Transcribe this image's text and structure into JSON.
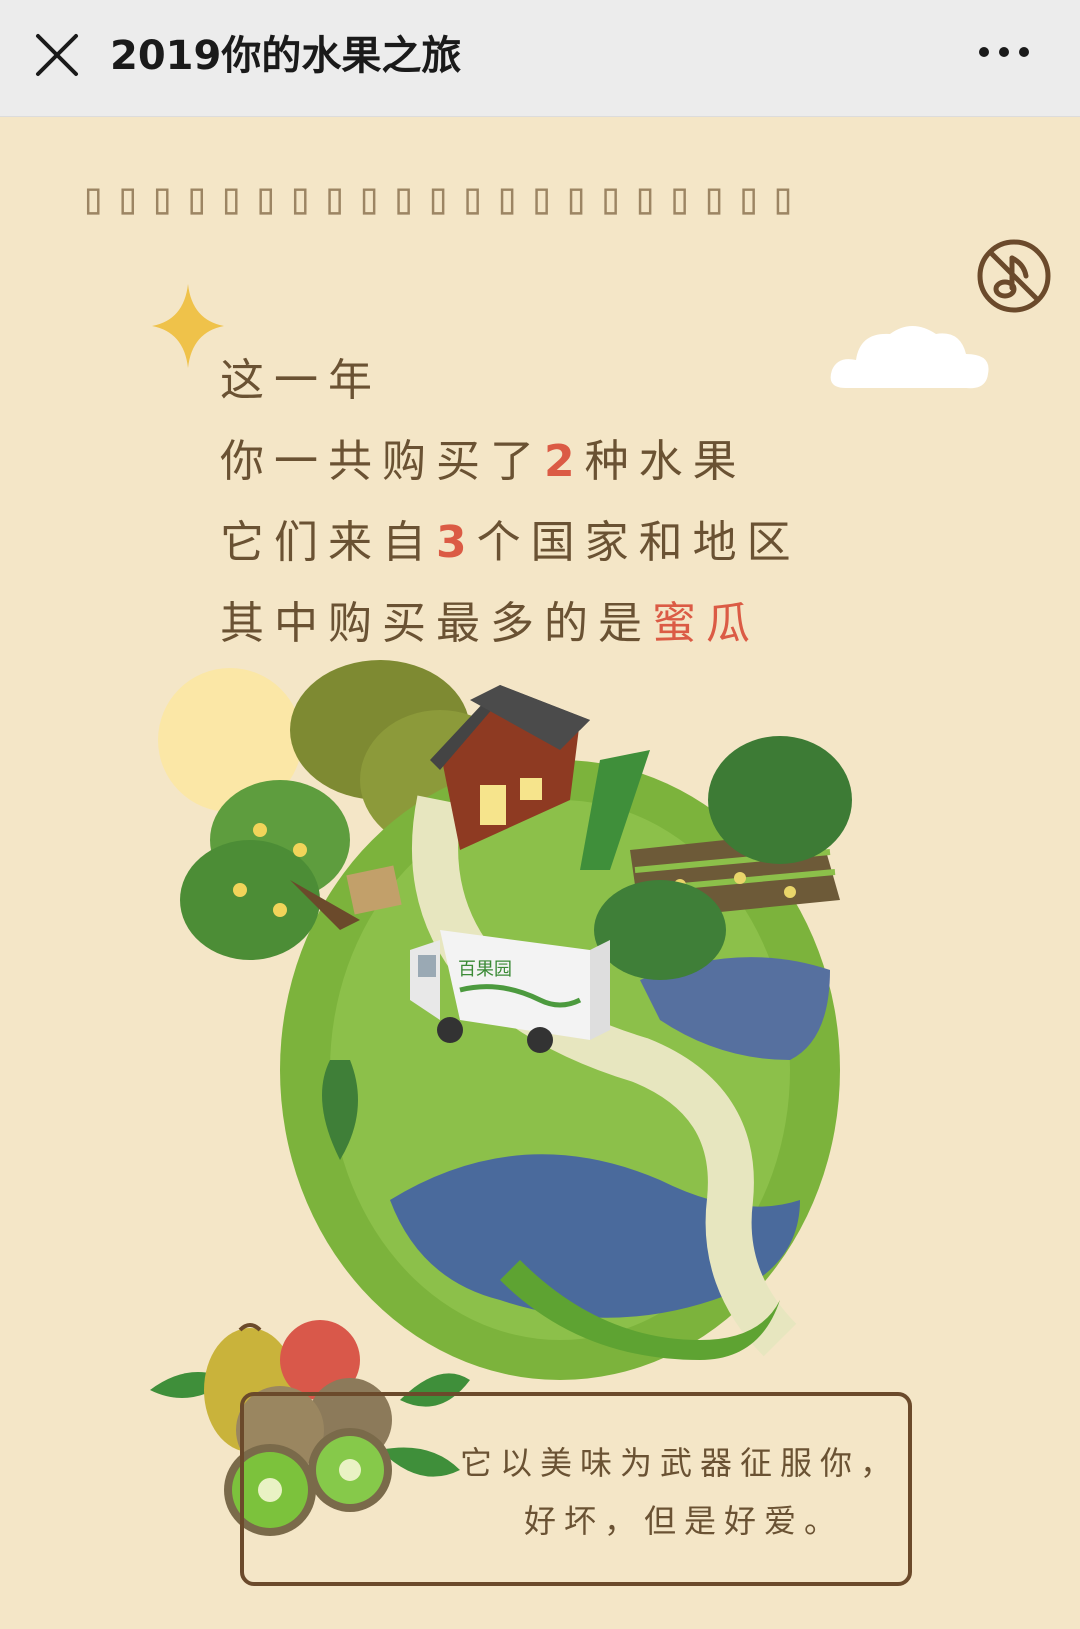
{
  "header": {
    "title": "2019你的水果之旅",
    "close_icon": "close-icon",
    "more_icon": "more-dots-icon"
  },
  "banner_glyphs": "▯▯▯▯▯▯▯▯▯▯▯▯▯▯▯▯▯▯▯▯▯",
  "music_toggle": {
    "icon": "music-off-icon",
    "state": "muted"
  },
  "intro": {
    "line1": "这一年",
    "line2_pre": "你一共购买了",
    "fruit_count": "2",
    "line2_post": "种水果",
    "line3_pre": "它们来自",
    "region_count": "3",
    "line3_post": "个国家和地区",
    "line4_pre": "其中购买最多的是",
    "top_fruit": "蜜瓜"
  },
  "illustration": {
    "truck_text": "百果园"
  },
  "caption": {
    "line1": "它以美味为武器征服你，",
    "line2": "好坏，但是好爱。"
  },
  "colors": {
    "background": "#f4e6c7",
    "topbar": "#ececec",
    "text": "#6a5233",
    "highlight": "#db5b45",
    "globe_green": "#7cb33c",
    "water_blue": "#4a6a9c"
  }
}
